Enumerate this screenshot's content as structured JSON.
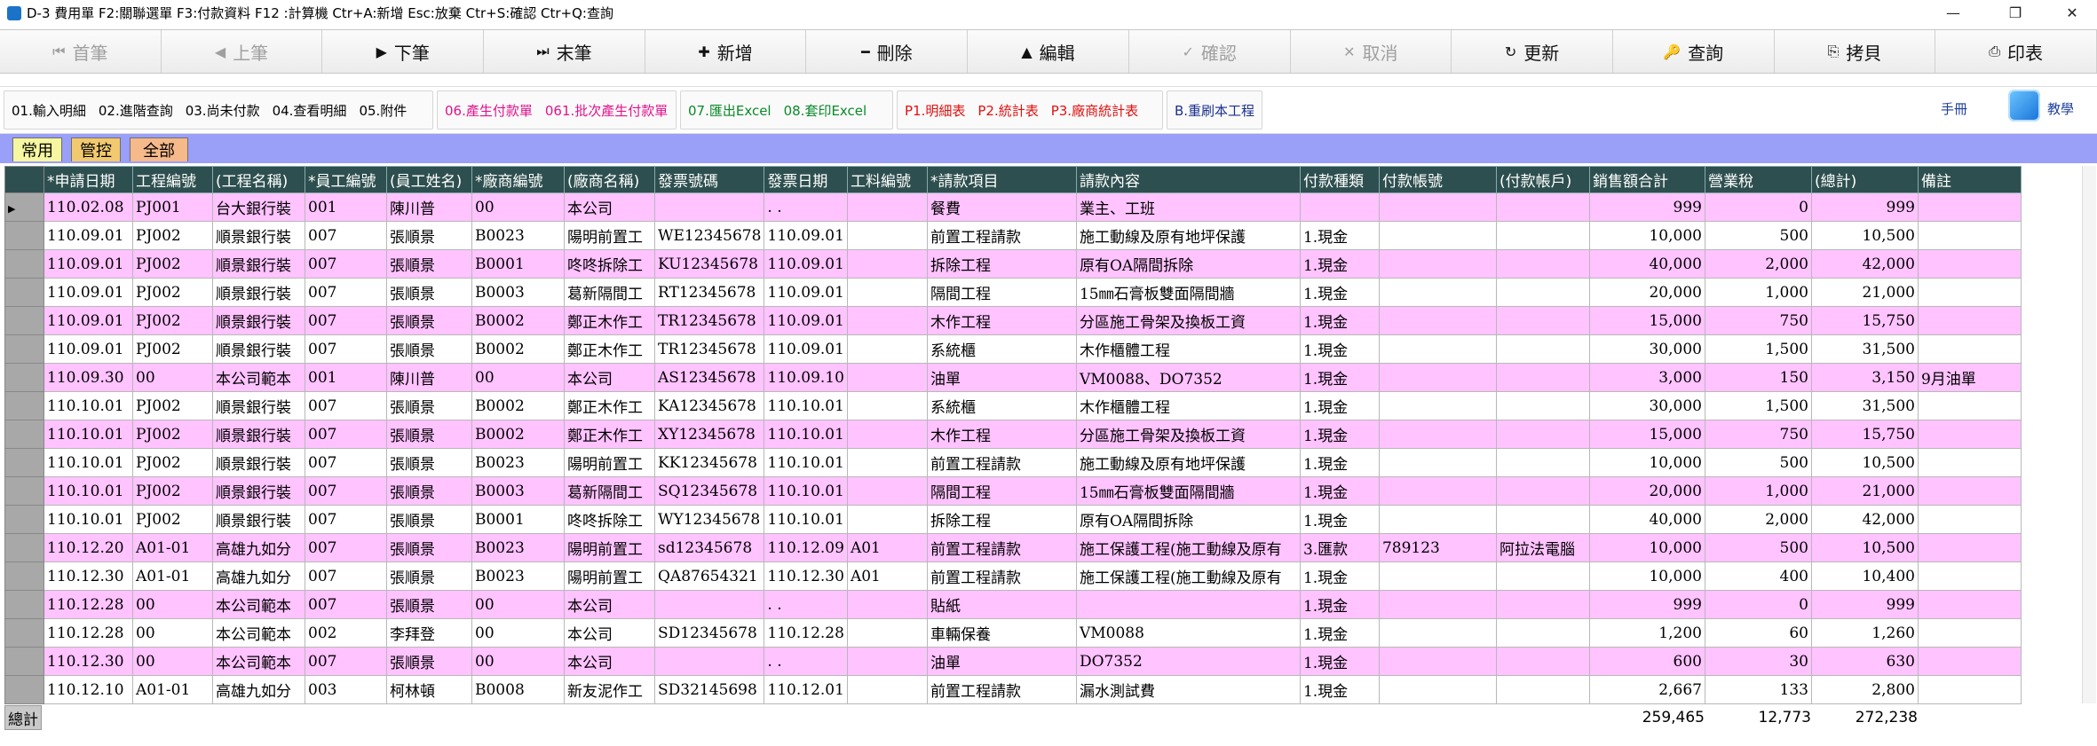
{
  "window": {
    "title": "D-3  費用單  F2:關聯選單  F3:付款資料  F12 :計算機  Ctr+A:新增  Esc:放棄  Ctr+S:確認  Ctr+Q:查詢",
    "minimize": "—",
    "maximize": "❐",
    "close": "✕"
  },
  "toolbar": [
    {
      "label": "首筆",
      "icon": "⏮",
      "disabled": true
    },
    {
      "label": "上筆",
      "icon": "◀",
      "disabled": true
    },
    {
      "label": "下筆",
      "icon": "▶",
      "disabled": false
    },
    {
      "label": "末筆",
      "icon": "⏭",
      "disabled": false
    },
    {
      "label": "新增",
      "icon": "✚",
      "disabled": false
    },
    {
      "label": "刪除",
      "icon": "━",
      "disabled": false
    },
    {
      "label": "編輯",
      "icon": "▲",
      "disabled": false
    },
    {
      "label": "確認",
      "icon": "✓",
      "disabled": true
    },
    {
      "label": "取消",
      "icon": "✕",
      "disabled": true
    },
    {
      "label": "更新",
      "icon": "↻",
      "disabled": false
    },
    {
      "label": "查詢",
      "icon": "🔑",
      "disabled": false
    },
    {
      "label": "拷貝",
      "icon": "⎘",
      "disabled": false
    },
    {
      "label": "印表",
      "icon": "⎙",
      "disabled": false
    }
  ],
  "functions": {
    "group1": [
      "01.輸入明細",
      "02.進階查詢",
      "03.尚未付款",
      "04.查看明細",
      "05.附件"
    ],
    "group2": [
      "06.產生付款單",
      "061.批次產生付款單"
    ],
    "group3": [
      "07.匯出Excel",
      "08.套印Excel"
    ],
    "group4": [
      "P1.明細表",
      "P2.統計表",
      "P3.廠商統計表"
    ],
    "group5": [
      "B.重刷本工程"
    ],
    "help": "手冊",
    "teach": "教學"
  },
  "colors": {
    "group1": "#000000",
    "group2": "#e0138c",
    "group3": "#0a8a2a",
    "group4": "#e01010",
    "group5": "#1a2f8f"
  },
  "tabs": [
    "常用",
    "管控",
    "全部"
  ],
  "tab_colors": [
    "#f7f7a0",
    "#f2c96e",
    "#f6b98a"
  ],
  "columns": [
    "*申請日期",
    "工程編號",
    "(工程名稱)",
    "*員工編號",
    "(員工姓名)",
    "*廠商編號",
    "(廠商名稱)",
    "發票號碼",
    "發票日期",
    "工料編號",
    "*請款項目",
    "請款內容",
    "付款種類",
    "付款帳號",
    "(付款帳戶)",
    "銷售額合計",
    "營業稅",
    "(總計)",
    "備註"
  ],
  "rows": [
    [
      "110.02.08",
      "PJ001",
      "台大銀行裝",
      "001",
      "陳川普",
      "00",
      "本公司",
      "",
      "  .  .",
      "",
      "餐費",
      "業主、工班",
      "",
      "",
      "",
      "999",
      "0",
      "999",
      ""
    ],
    [
      "110.09.01",
      "PJ002",
      "順景銀行裝",
      "007",
      "張順景",
      "B0023",
      "陽明前置工",
      "WE12345678",
      "110.09.01",
      "",
      "前置工程請款",
      "施工動線及原有地坪保護",
      "1.現金",
      "",
      "",
      "10,000",
      "500",
      "10,500",
      ""
    ],
    [
      "110.09.01",
      "PJ002",
      "順景銀行裝",
      "007",
      "張順景",
      "B0001",
      "咚咚拆除工",
      "KU12345678",
      "110.09.01",
      "",
      "拆除工程",
      "原有OA隔間拆除",
      "1.現金",
      "",
      "",
      "40,000",
      "2,000",
      "42,000",
      ""
    ],
    [
      "110.09.01",
      "PJ002",
      "順景銀行裝",
      "007",
      "張順景",
      "B0003",
      "葛新隔間工",
      "RT12345678",
      "110.09.01",
      "",
      "隔間工程",
      "15㎜石膏板雙面隔間牆",
      "1.現金",
      "",
      "",
      "20,000",
      "1,000",
      "21,000",
      ""
    ],
    [
      "110.09.01",
      "PJ002",
      "順景銀行裝",
      "007",
      "張順景",
      "B0002",
      "鄭正木作工",
      "TR12345678",
      "110.09.01",
      "",
      "木作工程",
      "分區施工骨架及換板工資",
      "1.現金",
      "",
      "",
      "15,000",
      "750",
      "15,750",
      ""
    ],
    [
      "110.09.01",
      "PJ002",
      "順景銀行裝",
      "007",
      "張順景",
      "B0002",
      "鄭正木作工",
      "TR12345678",
      "110.09.01",
      "",
      "系統櫃",
      "木作櫃體工程",
      "1.現金",
      "",
      "",
      "30,000",
      "1,500",
      "31,500",
      ""
    ],
    [
      "110.09.30",
      "00",
      "本公司範本",
      "001",
      "陳川普",
      "00",
      "本公司",
      "AS12345678",
      "110.09.10",
      "",
      "油單",
      "VM0088、DO7352",
      "1.現金",
      "",
      "",
      "3,000",
      "150",
      "3,150",
      "9月油單"
    ],
    [
      "110.10.01",
      "PJ002",
      "順景銀行裝",
      "007",
      "張順景",
      "B0002",
      "鄭正木作工",
      "KA12345678",
      "110.10.01",
      "",
      "系統櫃",
      "木作櫃體工程",
      "1.現金",
      "",
      "",
      "30,000",
      "1,500",
      "31,500",
      ""
    ],
    [
      "110.10.01",
      "PJ002",
      "順景銀行裝",
      "007",
      "張順景",
      "B0002",
      "鄭正木作工",
      "XY12345678",
      "110.10.01",
      "",
      "木作工程",
      "分區施工骨架及換板工資",
      "1.現金",
      "",
      "",
      "15,000",
      "750",
      "15,750",
      ""
    ],
    [
      "110.10.01",
      "PJ002",
      "順景銀行裝",
      "007",
      "張順景",
      "B0023",
      "陽明前置工",
      "KK12345678",
      "110.10.01",
      "",
      "前置工程請款",
      "施工動線及原有地坪保護",
      "1.現金",
      "",
      "",
      "10,000",
      "500",
      "10,500",
      ""
    ],
    [
      "110.10.01",
      "PJ002",
      "順景銀行裝",
      "007",
      "張順景",
      "B0003",
      "葛新隔間工",
      "SQ12345678",
      "110.10.01",
      "",
      "隔間工程",
      "15㎜石膏板雙面隔間牆",
      "1.現金",
      "",
      "",
      "20,000",
      "1,000",
      "21,000",
      ""
    ],
    [
      "110.10.01",
      "PJ002",
      "順景銀行裝",
      "007",
      "張順景",
      "B0001",
      "咚咚拆除工",
      "WY12345678",
      "110.10.01",
      "",
      "拆除工程",
      "原有OA隔間拆除",
      "1.現金",
      "",
      "",
      "40,000",
      "2,000",
      "42,000",
      ""
    ],
    [
      "110.12.20",
      "A01-01",
      "高雄九如分",
      "007",
      "張順景",
      "B0023",
      "陽明前置工",
      "sd12345678",
      "110.12.09",
      "A01",
      "前置工程請款",
      "施工保護工程(施工動線及原有",
      "3.匯款",
      "789123",
      "阿拉法電腦",
      "10,000",
      "500",
      "10,500",
      ""
    ],
    [
      "110.12.30",
      "A01-01",
      "高雄九如分",
      "007",
      "張順景",
      "B0023",
      "陽明前置工",
      "QA87654321",
      "110.12.30",
      "A01",
      "前置工程請款",
      "施工保護工程(施工動線及原有",
      "1.現金",
      "",
      "",
      "10,000",
      "400",
      "10,400",
      ""
    ],
    [
      "110.12.28",
      "00",
      "本公司範本",
      "007",
      "張順景",
      "00",
      "本公司",
      "",
      "  .  .",
      "",
      "貼紙",
      "",
      "1.現金",
      "",
      "",
      "999",
      "0",
      "999",
      ""
    ],
    [
      "110.12.28",
      "00",
      "本公司範本",
      "002",
      "李拜登",
      "00",
      "本公司",
      "SD12345678",
      "110.12.28",
      "",
      "車輛保養",
      "VM0088",
      "1.現金",
      "",
      "",
      "1,200",
      "60",
      "1,260",
      ""
    ],
    [
      "110.12.30",
      "00",
      "本公司範本",
      "007",
      "張順景",
      "00",
      "本公司",
      "",
      "  .  .",
      "",
      "油單",
      "DO7352",
      "1.現金",
      "",
      "",
      "600",
      "30",
      "630",
      ""
    ],
    [
      "110.12.10",
      "A01-01",
      "高雄九如分",
      "003",
      "柯林頓",
      "B0008",
      "新友泥作工",
      "SD32145698",
      "110.12.01",
      "",
      "前置工程請款",
      "漏水測試費",
      "1.現金",
      "",
      "",
      "2,667",
      "133",
      "2,800",
      ""
    ]
  ],
  "row_colors": [
    "pink",
    "white",
    "pink",
    "white",
    "pink",
    "white",
    "pink",
    "white",
    "pink",
    "white",
    "pink",
    "white",
    "pink",
    "white",
    "pink",
    "white",
    "pink",
    "white"
  ],
  "totals": {
    "label": "總計",
    "sales": "259,465",
    "tax": "12,773",
    "total": "272,238"
  }
}
